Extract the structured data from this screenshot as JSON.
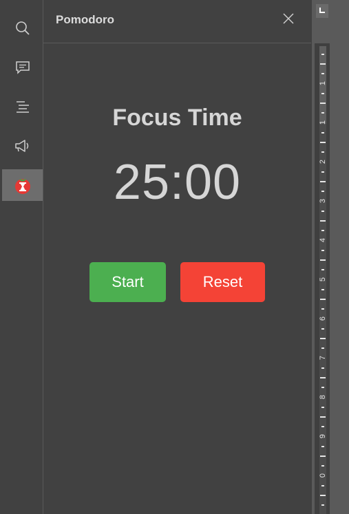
{
  "sidebar": {
    "items": [
      {
        "name": "search",
        "icon": "search-icon"
      },
      {
        "name": "comments",
        "icon": "comment-icon"
      },
      {
        "name": "navigation",
        "icon": "text-align-icon"
      },
      {
        "name": "feedback",
        "icon": "megaphone-icon"
      },
      {
        "name": "pomodoro",
        "icon": "tomato-icon",
        "active": true
      }
    ]
  },
  "panel": {
    "title": "Pomodoro",
    "close_icon": "close-icon"
  },
  "timer": {
    "heading": "Focus Time",
    "display": "25:00"
  },
  "buttons": {
    "start_label": "Start",
    "reset_label": "Reset",
    "start_color": "#4caf50",
    "reset_color": "#f44336"
  },
  "ruler": {
    "numbers": [
      "1",
      "1",
      "2",
      "3",
      "4",
      "5",
      "6",
      "7",
      "8",
      "9",
      "0"
    ]
  },
  "colors": {
    "background": "#414141",
    "text": "#d6d6d6"
  }
}
